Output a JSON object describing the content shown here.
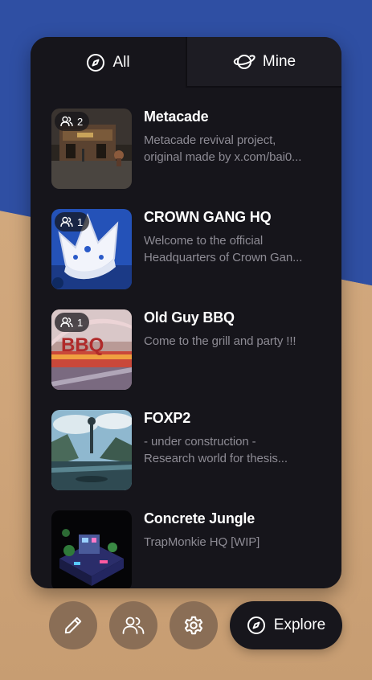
{
  "tabs": [
    {
      "label": "All",
      "icon": "compass-icon",
      "active": true
    },
    {
      "label": "Mine",
      "icon": "planet-icon",
      "active": false
    }
  ],
  "worlds": [
    {
      "title": "Metacade",
      "desc_line1": "Metacade revival project,",
      "desc_line2": "original made by x.com/bai0...",
      "online": "2"
    },
    {
      "title": "CROWN GANG HQ",
      "desc_line1": "Welcome to the official",
      "desc_line2": "Headquarters of Crown Gan...",
      "online": "1"
    },
    {
      "title": "Old Guy BBQ",
      "desc_line1": "Come to the grill and party !!!",
      "desc_line2": "",
      "online": "1"
    },
    {
      "title": "FOXP2",
      "desc_line1": "- under construction -",
      "desc_line2": "Research world for thesis...",
      "online": ""
    },
    {
      "title": "Concrete Jungle",
      "desc_line1": "TrapMonkie HQ [WIP]",
      "desc_line2": "",
      "online": ""
    }
  ],
  "thumb_text": {
    "bbq": "BBQ"
  },
  "toolbar": {
    "edit_icon": "pencil-icon",
    "people_icon": "people-icon",
    "settings_icon": "gear-icon",
    "explore_label": "Explore",
    "explore_icon": "compass-icon"
  },
  "colors": {
    "panel": "#16151b",
    "sky": "#2f4fa3",
    "sand": "#cfa57a",
    "fab": "#8a6e56",
    "muted_text": "#8d8b94"
  }
}
